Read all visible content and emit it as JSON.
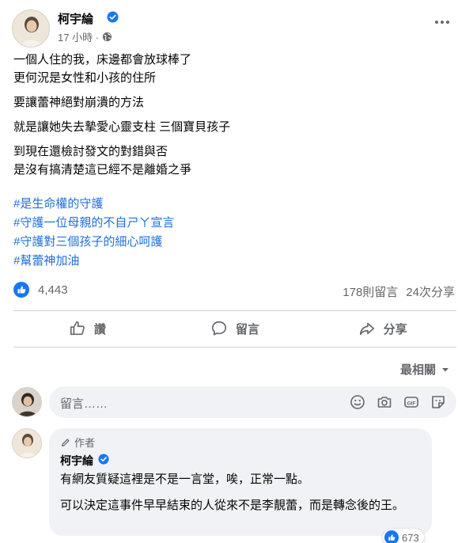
{
  "post": {
    "author": "柯宇綸",
    "time": "17 小時 ·",
    "paragraphs": [
      [
        "一個人住的我，床邊都會放球棒了",
        "更何況是女性和小孩的住所"
      ],
      [
        "要讓蕾神絕對崩潰的方法"
      ],
      [
        "就是讓她失去摯愛心靈支柱 三個寶貝孩子"
      ],
      [
        "到現在還檢討發文的對錯與否",
        "是沒有搞清楚這已經不是離婚之爭"
      ]
    ],
    "hashtags": [
      "#是生命權的守護",
      "#守護一位母親的不自ㄕㄚ宣言",
      "#守護對三個孩子的細心呵護",
      "#幫蕾神加油"
    ]
  },
  "stats": {
    "likes": "4,443",
    "comments": "178則留言",
    "shares": "24次分享"
  },
  "actions": {
    "like": "讚",
    "comment": "留言",
    "share": "分享"
  },
  "sort": {
    "label": "最相關"
  },
  "comment_box": {
    "placeholder": "留言……"
  },
  "top_comment": {
    "badge": "作者",
    "name": "柯宇綸",
    "paragraphs": [
      "有網友質疑這裡是不是一言堂，唉，正常一點。",
      "可以決定這事件早早結束的人從來不是李靚蕾，而是轉念後的王。"
    ],
    "reactions": "673"
  },
  "colors": {
    "accent": "#1877f2",
    "hashtag": "#216fdb",
    "secondary_text": "#65676b",
    "bubble_bg": "#f0f2f5"
  },
  "icons": [
    "globe-icon",
    "more-icon",
    "like-icon",
    "comment-icon",
    "share-icon",
    "emoji-icon",
    "camera-icon",
    "gif-icon",
    "sticker-icon",
    "chevron-down-icon",
    "verified-icon"
  ]
}
